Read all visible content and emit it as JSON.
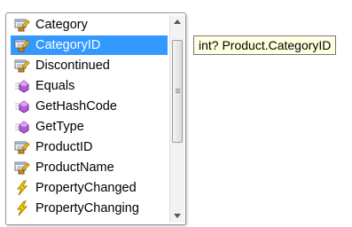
{
  "completion_list": {
    "items": [
      {
        "label": "Category",
        "icon": "property-icon"
      },
      {
        "label": "CategoryID",
        "icon": "property-icon",
        "selected": true
      },
      {
        "label": "Discontinued",
        "icon": "property-icon"
      },
      {
        "label": "Equals",
        "icon": "method-icon"
      },
      {
        "label": "GetHashCode",
        "icon": "method-icon"
      },
      {
        "label": "GetType",
        "icon": "method-icon"
      },
      {
        "label": "ProductID",
        "icon": "property-icon"
      },
      {
        "label": "ProductName",
        "icon": "property-icon"
      },
      {
        "label": "PropertyChanged",
        "icon": "event-icon"
      },
      {
        "label": "PropertyChanging",
        "icon": "event-icon"
      }
    ]
  },
  "tooltip": {
    "text": "int? Product.CategoryID"
  },
  "colors": {
    "selection": "#3399ff",
    "tooltip_bg": "#ffffe1"
  }
}
